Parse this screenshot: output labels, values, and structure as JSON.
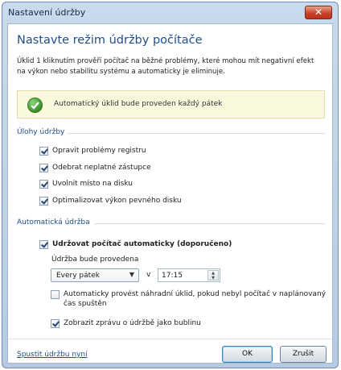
{
  "window": {
    "title": "Nastavení údržby",
    "close_glyph": "✕"
  },
  "heading": "Nastavte režim údržby počítače",
  "description": "Úklid 1 kliknutím prověří počítač na běžné problémy, které mohou mít negativní efekt na výkon nebo stabilitu systému a automaticky je eliminuje.",
  "notice": {
    "icon": "green-check-icon",
    "text": "Automatický úklid bude proveden každý pátek"
  },
  "tasks_section": {
    "title": "Úlohy údržby",
    "items": [
      {
        "label": "Opravit problémy registru",
        "checked": true
      },
      {
        "label": "Odebrat neplatné zástupce",
        "checked": true
      },
      {
        "label": "Uvolnit místo na disku",
        "checked": true
      },
      {
        "label": "Optimalizovat výkon pevného disku",
        "checked": true
      }
    ]
  },
  "auto_section": {
    "title": "Automatická údržba",
    "auto_checkbox": {
      "label": "Udržovat počítač automaticky (doporučeno)",
      "checked": true
    },
    "schedule_label": "Údržba bude provedena",
    "day_select": {
      "value": "Every pátek",
      "arrow": "▼"
    },
    "at_label": "v",
    "time_input": {
      "value": "17:15",
      "spin_up": "▲",
      "spin_down": "▼"
    },
    "fallback_checkbox": {
      "label": "Automaticky provést náhradní úklid, pokud nebyl počítač v naplánovaný",
      "label_line2": "čas spuštěn",
      "checked": false
    },
    "bubble_checkbox": {
      "label": "Zobrazit zprávu o údržbě jako bublinu",
      "checked": true
    }
  },
  "footer": {
    "run_link": "Spustit údržbu nyní",
    "ok_label": "OK",
    "cancel_label": "Zrušit"
  },
  "colors": {
    "heading": "#1e4e8c",
    "link": "#1d4fa0",
    "notice_bg": "#fbf9dd",
    "close_button": "#c9442b",
    "check_green": "#3a8d2b"
  }
}
